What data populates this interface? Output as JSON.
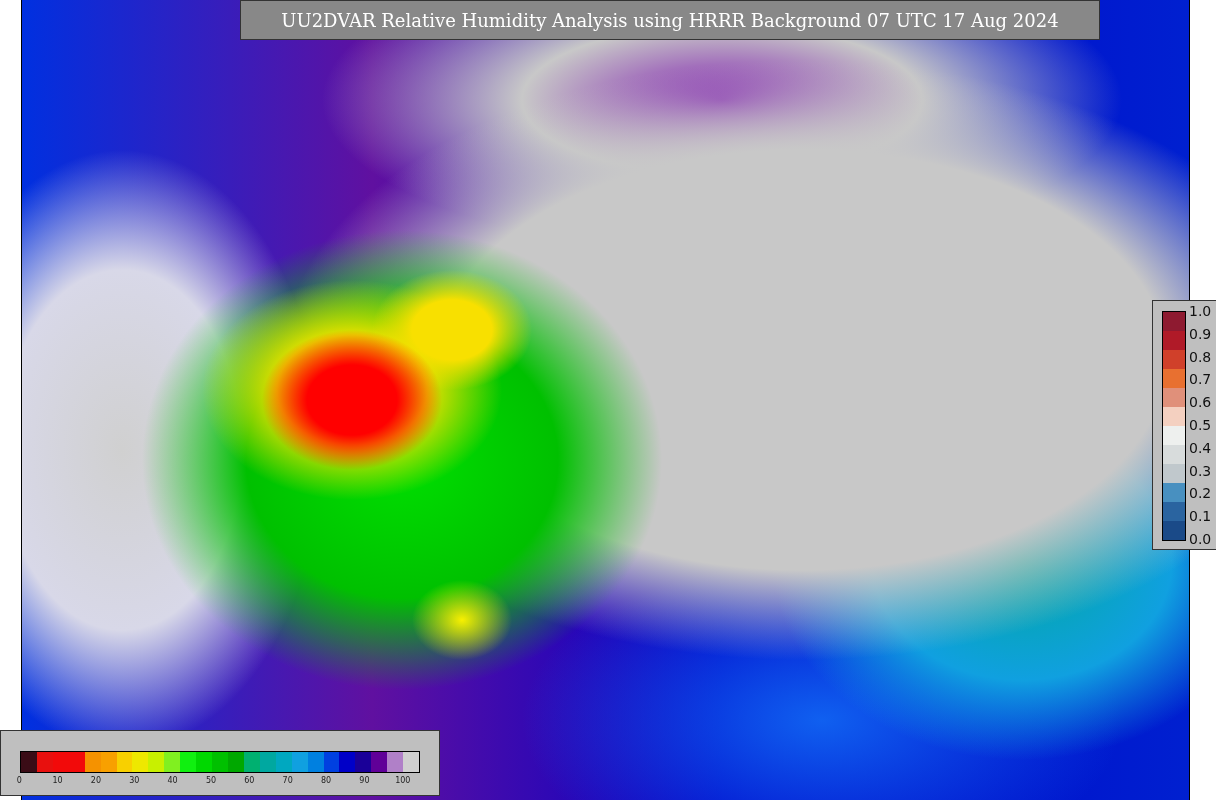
{
  "title": "UU2DVAR Relative Humidity Analysis using HRRR Background 07 UTC 17 Aug 2024",
  "humidity_colorbar": {
    "ticks": [
      "0",
      "10",
      "20",
      "30",
      "40",
      "50",
      "60",
      "70",
      "80",
      "90",
      "100"
    ],
    "segments": [
      {
        "color": "#3a0c16"
      },
      {
        "color": "#e8100e"
      },
      {
        "color": "#f20a0a"
      },
      {
        "color": "#f20a0a"
      },
      {
        "color": "#f59200"
      },
      {
        "color": "#f8a000"
      },
      {
        "color": "#f8d000"
      },
      {
        "color": "#eee800"
      },
      {
        "color": "#c8f000"
      },
      {
        "color": "#80f020"
      },
      {
        "color": "#10f010"
      },
      {
        "color": "#00d800"
      },
      {
        "color": "#00c000"
      },
      {
        "color": "#00a800"
      },
      {
        "color": "#00b070"
      },
      {
        "color": "#00a8a0"
      },
      {
        "color": "#00a8c0"
      },
      {
        "color": "#10a0e0"
      },
      {
        "color": "#0080e0"
      },
      {
        "color": "#0040e0"
      },
      {
        "color": "#0000c8"
      },
      {
        "color": "#1a0098"
      },
      {
        "color": "#600098"
      },
      {
        "color": "#b080c8"
      },
      {
        "color": "#d0d0d0"
      }
    ]
  },
  "observation_colorbar": {
    "ticks": [
      "1.0",
      "0.9",
      "0.8",
      "0.7",
      "0.6",
      "0.5",
      "0.4",
      "0.3",
      "0.2",
      "0.1",
      "0.0"
    ],
    "segments": [
      {
        "color": "#8e1a30"
      },
      {
        "color": "#b01a28"
      },
      {
        "color": "#d0402a"
      },
      {
        "color": "#e87030"
      },
      {
        "color": "#e0907a"
      },
      {
        "color": "#f4d0c0"
      },
      {
        "color": "#eef0ee"
      },
      {
        "color": "#d8dcdc"
      },
      {
        "color": "#c0c8cc"
      },
      {
        "color": "#4890c0"
      },
      {
        "color": "#2a64a0"
      },
      {
        "color": "#1a4a88"
      }
    ]
  }
}
